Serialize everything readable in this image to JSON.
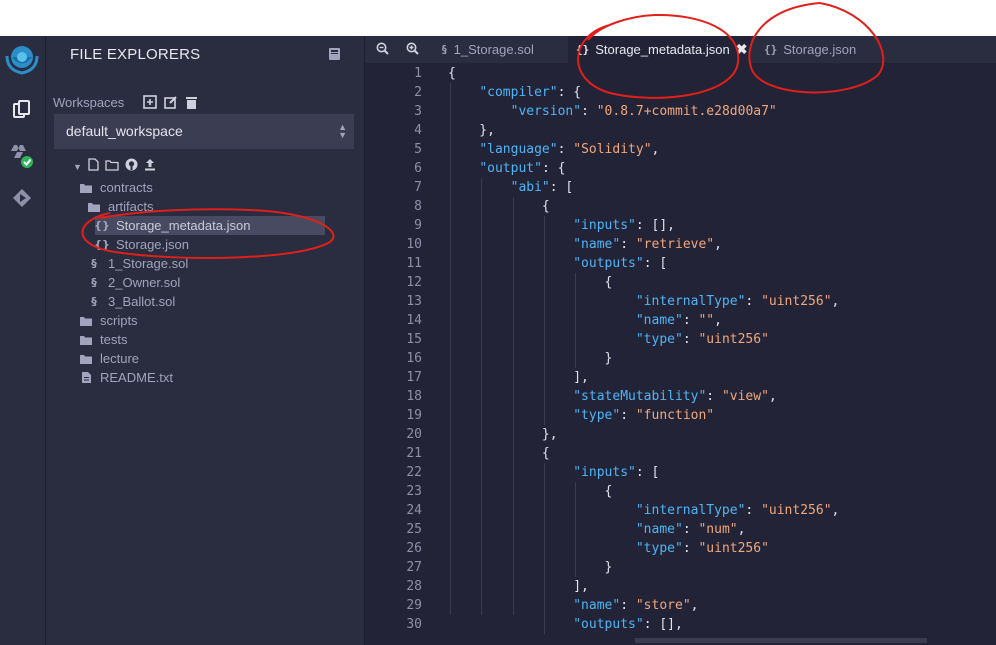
{
  "side_panel": {
    "title": "FILE EXPLORERS",
    "workspaces_label": "Workspaces",
    "workspace_selected": "default_workspace"
  },
  "file_tree": [
    {
      "name": "contracts",
      "kind": "folder",
      "depth": 0
    },
    {
      "name": "artifacts",
      "kind": "folder",
      "depth": 1
    },
    {
      "name": "Storage_metadata.json",
      "kind": "json",
      "depth": 2,
      "selected": true
    },
    {
      "name": "Storage.json",
      "kind": "json",
      "depth": 2
    },
    {
      "name": "1_Storage.sol",
      "kind": "sol",
      "depth": 1
    },
    {
      "name": "2_Owner.sol",
      "kind": "sol",
      "depth": 1
    },
    {
      "name": "3_Ballot.sol",
      "kind": "sol",
      "depth": 1
    },
    {
      "name": "scripts",
      "kind": "folder",
      "depth": 0
    },
    {
      "name": "tests",
      "kind": "folder",
      "depth": 0
    },
    {
      "name": "lecture",
      "kind": "folder",
      "depth": 0
    },
    {
      "name": "README.txt",
      "kind": "file",
      "depth": 0
    }
  ],
  "tabs": [
    {
      "label": "1_Storage.sol",
      "icon": "solidity-icon",
      "active": false
    },
    {
      "label": "Storage_metadata.json",
      "icon": "json-icon",
      "active": true
    },
    {
      "label": "Storage.json",
      "icon": "json-icon",
      "active": false
    }
  ],
  "code_lines": [
    [
      [
        "p",
        "{"
      ]
    ],
    [
      [
        "p",
        "    "
      ],
      [
        "k",
        "\"compiler\""
      ],
      [
        "p",
        ": {"
      ]
    ],
    [
      [
        "p",
        "        "
      ],
      [
        "k",
        "\"version\""
      ],
      [
        "p",
        ": "
      ],
      [
        "s",
        "\"0.8.7+commit.e28d00a7\""
      ]
    ],
    [
      [
        "p",
        "    },"
      ]
    ],
    [
      [
        "p",
        "    "
      ],
      [
        "k",
        "\"language\""
      ],
      [
        "p",
        ": "
      ],
      [
        "s",
        "\"Solidity\""
      ],
      [
        "p",
        ","
      ]
    ],
    [
      [
        "p",
        "    "
      ],
      [
        "k",
        "\"output\""
      ],
      [
        "p",
        ": {"
      ]
    ],
    [
      [
        "p",
        "        "
      ],
      [
        "k",
        "\"abi\""
      ],
      [
        "p",
        ": ["
      ]
    ],
    [
      [
        "p",
        "            {"
      ]
    ],
    [
      [
        "p",
        "                "
      ],
      [
        "k",
        "\"inputs\""
      ],
      [
        "p",
        ": [],"
      ]
    ],
    [
      [
        "p",
        "                "
      ],
      [
        "k",
        "\"name\""
      ],
      [
        "p",
        ": "
      ],
      [
        "s",
        "\"retrieve\""
      ],
      [
        "p",
        ","
      ]
    ],
    [
      [
        "p",
        "                "
      ],
      [
        "k",
        "\"outputs\""
      ],
      [
        "p",
        ": ["
      ]
    ],
    [
      [
        "p",
        "                    {"
      ]
    ],
    [
      [
        "p",
        "                        "
      ],
      [
        "k",
        "\"internalType\""
      ],
      [
        "p",
        ": "
      ],
      [
        "s",
        "\"uint256\""
      ],
      [
        "p",
        ","
      ]
    ],
    [
      [
        "p",
        "                        "
      ],
      [
        "k",
        "\"name\""
      ],
      [
        "p",
        ": "
      ],
      [
        "s",
        "\"\""
      ],
      [
        "p",
        ","
      ]
    ],
    [
      [
        "p",
        "                        "
      ],
      [
        "k",
        "\"type\""
      ],
      [
        "p",
        ": "
      ],
      [
        "s",
        "\"uint256\""
      ]
    ],
    [
      [
        "p",
        "                    }"
      ]
    ],
    [
      [
        "p",
        "                ],"
      ]
    ],
    [
      [
        "p",
        "                "
      ],
      [
        "k",
        "\"stateMutability\""
      ],
      [
        "p",
        ": "
      ],
      [
        "s",
        "\"view\""
      ],
      [
        "p",
        ","
      ]
    ],
    [
      [
        "p",
        "                "
      ],
      [
        "k",
        "\"type\""
      ],
      [
        "p",
        ": "
      ],
      [
        "s",
        "\"function\""
      ]
    ],
    [
      [
        "p",
        "            },"
      ]
    ],
    [
      [
        "p",
        "            {"
      ]
    ],
    [
      [
        "p",
        "                "
      ],
      [
        "k",
        "\"inputs\""
      ],
      [
        "p",
        ": ["
      ]
    ],
    [
      [
        "p",
        "                    {"
      ]
    ],
    [
      [
        "p",
        "                        "
      ],
      [
        "k",
        "\"internalType\""
      ],
      [
        "p",
        ": "
      ],
      [
        "s",
        "\"uint256\""
      ],
      [
        "p",
        ","
      ]
    ],
    [
      [
        "p",
        "                        "
      ],
      [
        "k",
        "\"name\""
      ],
      [
        "p",
        ": "
      ],
      [
        "s",
        "\"num\""
      ],
      [
        "p",
        ","
      ]
    ],
    [
      [
        "p",
        "                        "
      ],
      [
        "k",
        "\"type\""
      ],
      [
        "p",
        ": "
      ],
      [
        "s",
        "\"uint256\""
      ]
    ],
    [
      [
        "p",
        "                    }"
      ]
    ],
    [
      [
        "p",
        "                ],"
      ]
    ],
    [
      [
        "p",
        "                "
      ],
      [
        "k",
        "\"name\""
      ],
      [
        "p",
        ": "
      ],
      [
        "s",
        "\"store\""
      ],
      [
        "p",
        ","
      ]
    ],
    [
      [
        "p",
        "                "
      ],
      [
        "k",
        "\"outputs\""
      ],
      [
        "p",
        ": [],"
      ]
    ]
  ],
  "colors": {
    "background": "#222336",
    "panel": "#2a2c3f",
    "key": "#4fb5f5",
    "string": "#f1a77c",
    "annotation": "#e0201b"
  }
}
